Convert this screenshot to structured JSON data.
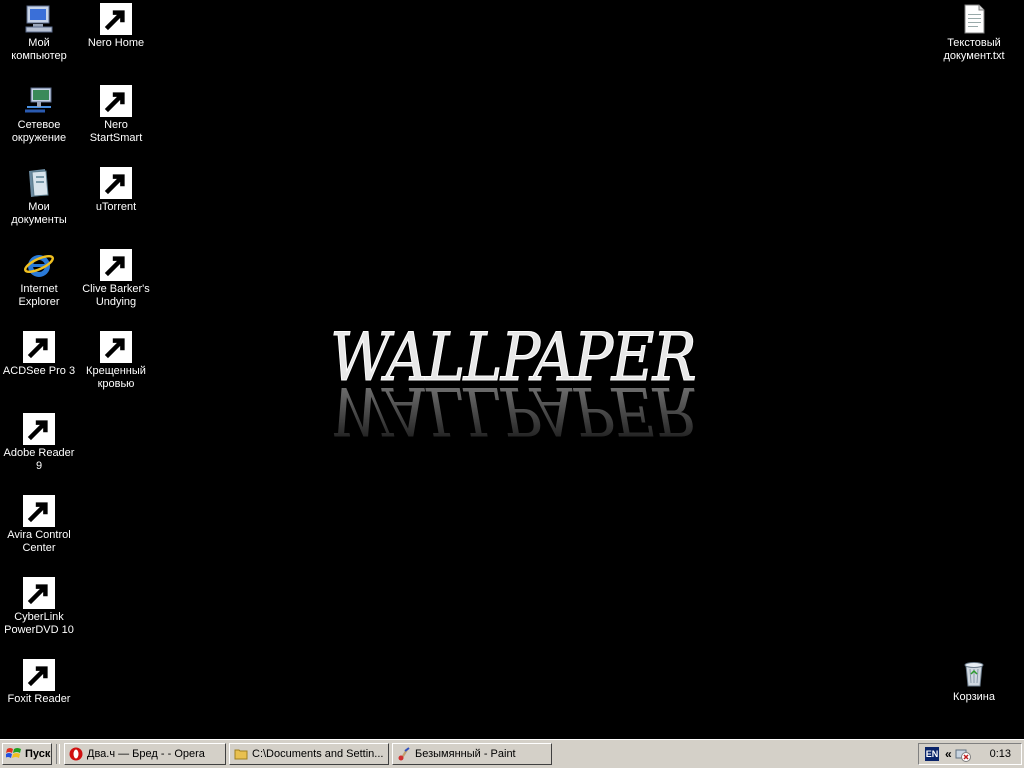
{
  "desktop": {
    "wallpaper_text": "WALLPAPER",
    "icons": {
      "my_computer": "Мой компьютер",
      "nero_home": "Nero Home",
      "network": "Сетевое окружение",
      "nero_startsmart": "Nero StartSmart",
      "my_documents": "Мои документы",
      "utorrent": "uTorrent",
      "internet_explorer": "Internet Explorer",
      "undying": "Clive Barker's Undying",
      "acdsee": "ACDSee Pro 3",
      "blood": "Крещенный кровью",
      "adobe_reader": "Adobe Reader 9",
      "avira": "Avira Control Center",
      "powerdvd": "CyberLink PowerDVD 10",
      "foxit": "Foxit Reader",
      "text_doc": "Текстовый документ.txt",
      "recycle_bin": "Корзина"
    }
  },
  "taskbar": {
    "start_label": "Пуск",
    "tasks": [
      {
        "label": "Два.ч — Бред - - Opera"
      },
      {
        "label": "C:\\Documents and Settin..."
      },
      {
        "label": "Безымянный - Paint"
      }
    ],
    "tray": {
      "lang": "EN",
      "clock": "0:13"
    }
  },
  "colors": {
    "desktop_bg": "#000000",
    "taskbar_bg": "#d4d0c8"
  }
}
